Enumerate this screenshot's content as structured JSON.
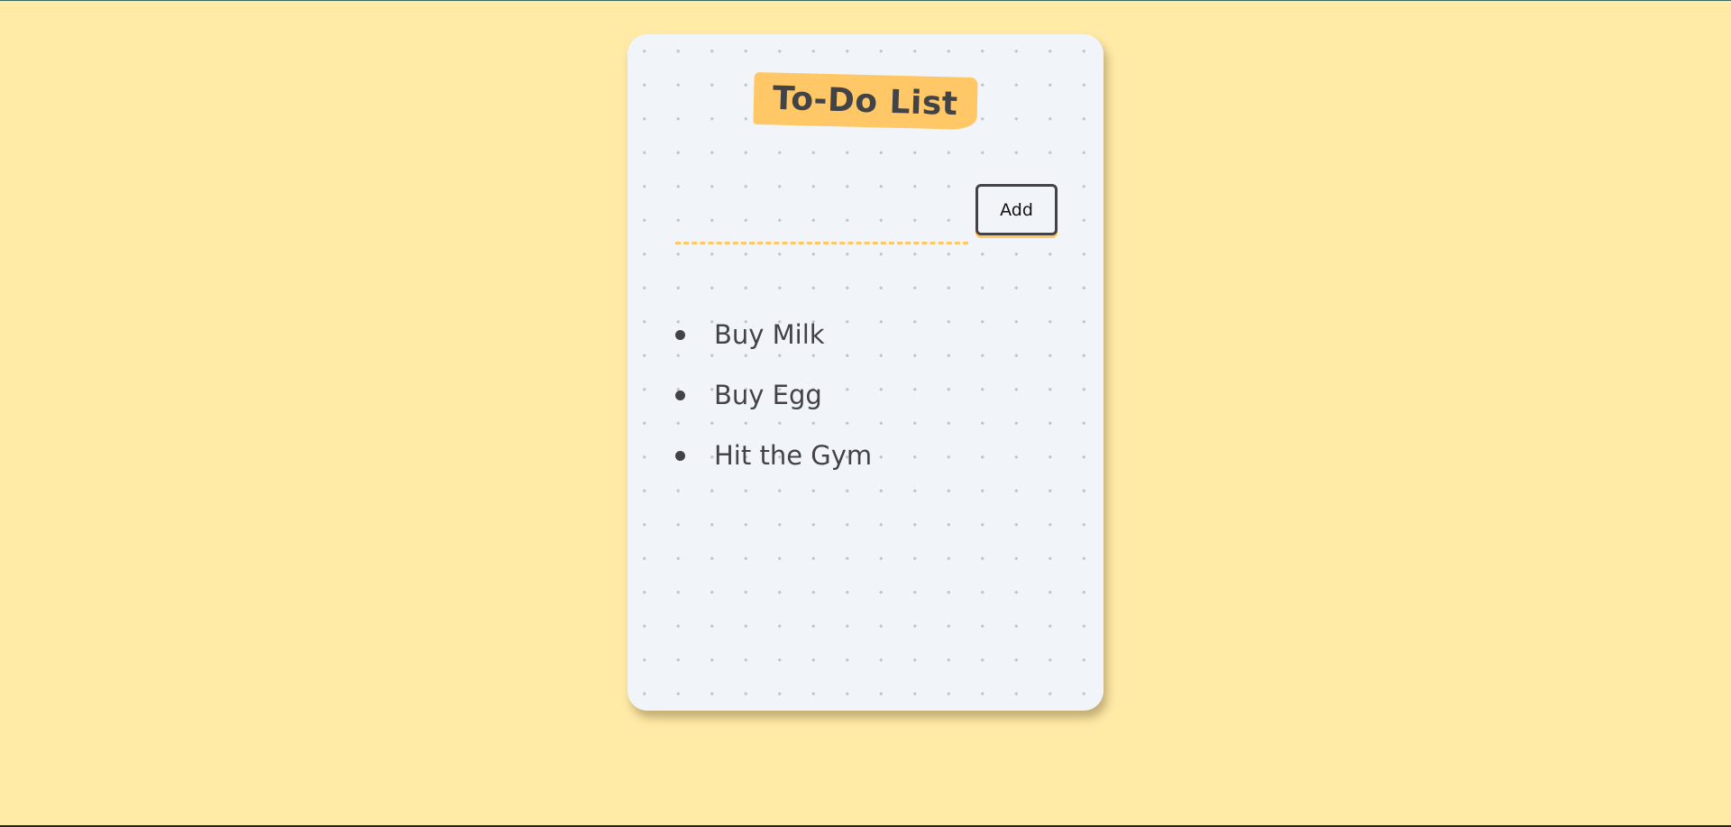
{
  "app": {
    "title": "To-Do List"
  },
  "form": {
    "input_value": "",
    "input_placeholder": "",
    "add_label": "Add"
  },
  "todos": [
    {
      "label": "Buy Milk"
    },
    {
      "label": "Buy Egg"
    },
    {
      "label": "Hit the Gym"
    }
  ],
  "colors": {
    "page_background": "#ffeaa6",
    "card_background": "#f1f5fa",
    "accent": "#ffc766",
    "text": "#414347"
  }
}
